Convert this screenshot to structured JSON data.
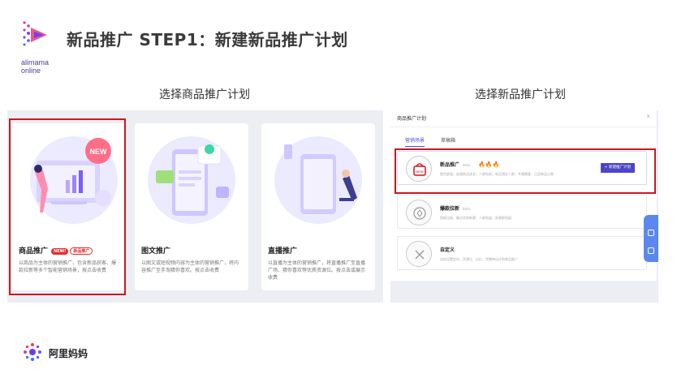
{
  "header": {
    "logo_text_line1": "alimama",
    "logo_text_line2": "online",
    "title": "新品推广 STEP1：新建新品推广计划"
  },
  "captions": {
    "left": "选择商品推广计划",
    "right": "选择新品推广计划"
  },
  "left_panel": {
    "cards": [
      {
        "title": "商品推广",
        "badge_new": "NEW!",
        "badge_tag": "新品推广",
        "illus_text": "NEW",
        "desc": "以商品为主体的营销推广，包含新品获客、爆款拉新等多个智能营销场景，按点击收费"
      },
      {
        "title": "图文推广",
        "desc": "以图文或短视频内容为主体的营销推广，将内容推广至手淘猜你喜欢。按点击收费"
      },
      {
        "title": "直播推广",
        "desc": "以直播为主体的营销推广，将直播推广至直播广场、猜你喜欢等优质资源位。按点击或展示收费"
      }
    ]
  },
  "dialog": {
    "title": "商品推广计划",
    "close": "×",
    "tabs": [
      {
        "label": "营销场景",
        "active": true
      },
      {
        "label": "草稿箱",
        "active": false
      }
    ],
    "options": [
      {
        "title": "新品推广",
        "beta": "beta",
        "fire": "🔥🔥🔥",
        "desc": "锁色屏道，加速新品成长；人群拓新，新品潜在人群；专属圈客，凸显新品心智",
        "button": "+ 新建推广计划",
        "icon_text": "NEW"
      },
      {
        "title": "爆款拉新",
        "beta": "beta",
        "desc": "智能拉新，触达优质新客；人群拓展，新客群拓展"
      },
      {
        "title": "自定义",
        "desc": "自由设置定向、资源位、出价，完整带出计划商品推广"
      }
    ]
  },
  "footer": {
    "brand": "阿里妈妈"
  },
  "colors": {
    "accent": "#4b45c9",
    "highlight": "#c8181f",
    "panel_bg": "#eceef4",
    "brand_purple": "#6a3de8"
  }
}
